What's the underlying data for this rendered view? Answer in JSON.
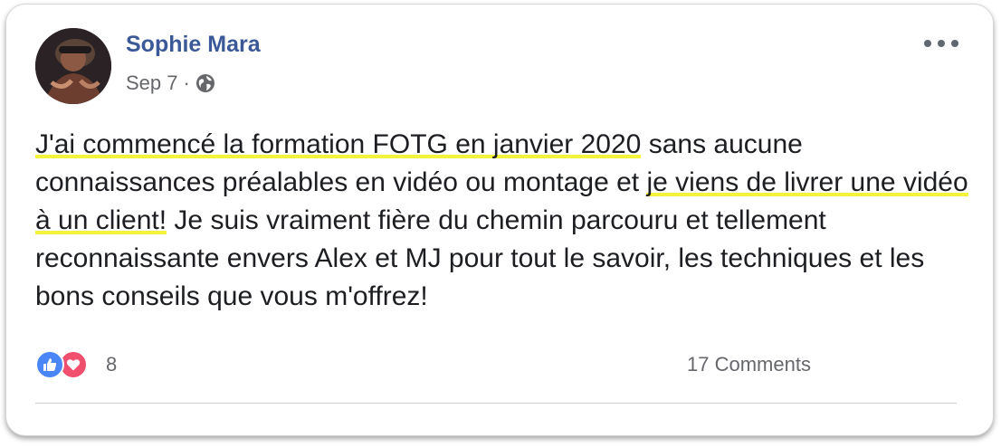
{
  "post": {
    "author": "Sophie Mara",
    "date": "Sep 7",
    "separator": "·",
    "privacy_icon": "globe-icon",
    "text": {
      "seg1": "J'ai commencé la formation FOTG en janvier 2020",
      "seg2": " sans aucune connaissances préalables en vidéo ou montage et ",
      "seg3": "je viens de livrer une vidéo à un client!",
      "seg4": " Je suis vraiment fière du chemin parcouru et tellement reconnaissante envers Alex et MJ pour tout le savoir, les techniques et les bons conseils que vous m'offrez!"
    },
    "highlight_color": "#f4f23a"
  },
  "footer": {
    "reaction_icons": [
      "like-icon",
      "love-icon"
    ],
    "reaction_count": "8",
    "comments_label": "17 Comments"
  },
  "colors": {
    "author_link": "#3b5998",
    "like": "#4a86f7",
    "love": "#f0506e",
    "secondary_text": "#65676b"
  }
}
